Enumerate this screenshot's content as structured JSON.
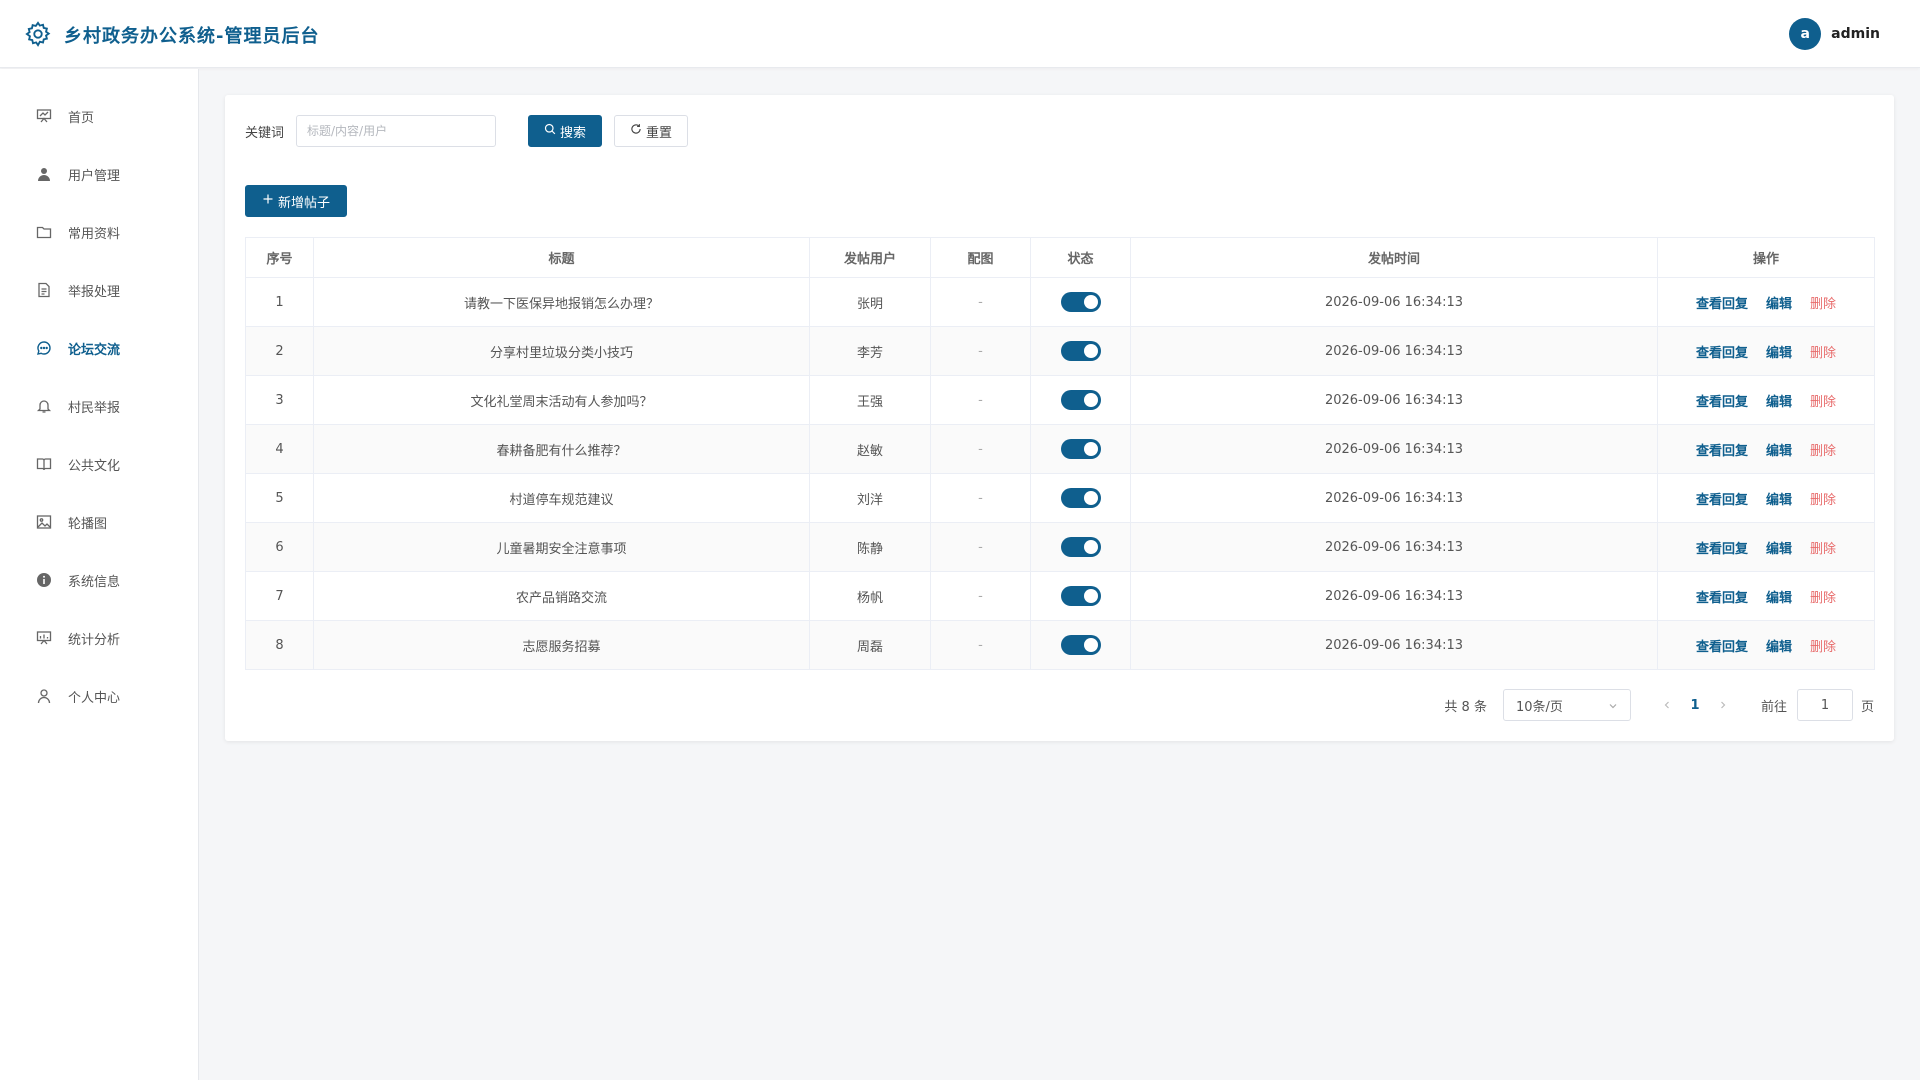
{
  "header": {
    "title": "乡村政务办公系统-管理员后台",
    "avatar_letter": "a",
    "username": "admin"
  },
  "sidebar": {
    "items": [
      {
        "label": "首页",
        "icon": "presentation-icon"
      },
      {
        "label": "用户管理",
        "icon": "user-filled-icon"
      },
      {
        "label": "常用资料",
        "icon": "folder-icon"
      },
      {
        "label": "举报处理",
        "icon": "document-icon"
      },
      {
        "label": "论坛交流",
        "icon": "chat-bubble-icon",
        "active": true
      },
      {
        "label": "村民举报",
        "icon": "bell-icon"
      },
      {
        "label": "公共文化",
        "icon": "book-icon"
      },
      {
        "label": "轮播图",
        "icon": "picture-icon"
      },
      {
        "label": "系统信息",
        "icon": "info-icon"
      },
      {
        "label": "统计分析",
        "icon": "chart-board-icon"
      },
      {
        "label": "个人中心",
        "icon": "user-outline-icon"
      }
    ]
  },
  "search": {
    "label": "关键词",
    "placeholder": "标题/内容/用户",
    "search_label": "搜索",
    "reset_label": "重置"
  },
  "toolbar": {
    "add_label": "新增帖子"
  },
  "table": {
    "columns": [
      "序号",
      "标题",
      "发帖用户",
      "配图",
      "状态",
      "发帖时间",
      "操作"
    ],
    "rows": [
      {
        "no": "1",
        "title": "请教一下医保异地报销怎么办理？",
        "user": "张明",
        "image": "-",
        "enabled": true,
        "time": "2026-09-06 16:34:13"
      },
      {
        "no": "2",
        "title": "分享村里垃圾分类小技巧",
        "user": "李芳",
        "image": "-",
        "enabled": true,
        "time": "2026-09-06 16:34:13"
      },
      {
        "no": "3",
        "title": "文化礼堂周末活动有人参加吗？",
        "user": "王强",
        "image": "-",
        "enabled": true,
        "time": "2026-09-06 16:34:13"
      },
      {
        "no": "4",
        "title": "春耕备肥有什么推荐？",
        "user": "赵敏",
        "image": "-",
        "enabled": true,
        "time": "2026-09-06 16:34:13"
      },
      {
        "no": "5",
        "title": "村道停车规范建议",
        "user": "刘洋",
        "image": "-",
        "enabled": true,
        "time": "2026-09-06 16:34:13"
      },
      {
        "no": "6",
        "title": "儿童暑期安全注意事项",
        "user": "陈静",
        "image": "-",
        "enabled": true,
        "time": "2026-09-06 16:34:13"
      },
      {
        "no": "7",
        "title": "农产品销路交流",
        "user": "杨帆",
        "image": "-",
        "enabled": true,
        "time": "2026-09-06 16:34:13"
      },
      {
        "no": "8",
        "title": "志愿服务招募",
        "user": "周磊",
        "image": "-",
        "enabled": true,
        "time": "2026-09-06 16:34:13"
      }
    ],
    "actions": {
      "view": "查看回复",
      "edit": "编辑",
      "delete": "删除"
    }
  },
  "pager": {
    "total": "共 8 条",
    "page_size": "10条/页",
    "current": "1",
    "goto_label": "前往",
    "goto_value": "1",
    "unit": "页"
  },
  "colors": {
    "brand": "#0f5f8e",
    "danger": "#e86a6a"
  }
}
